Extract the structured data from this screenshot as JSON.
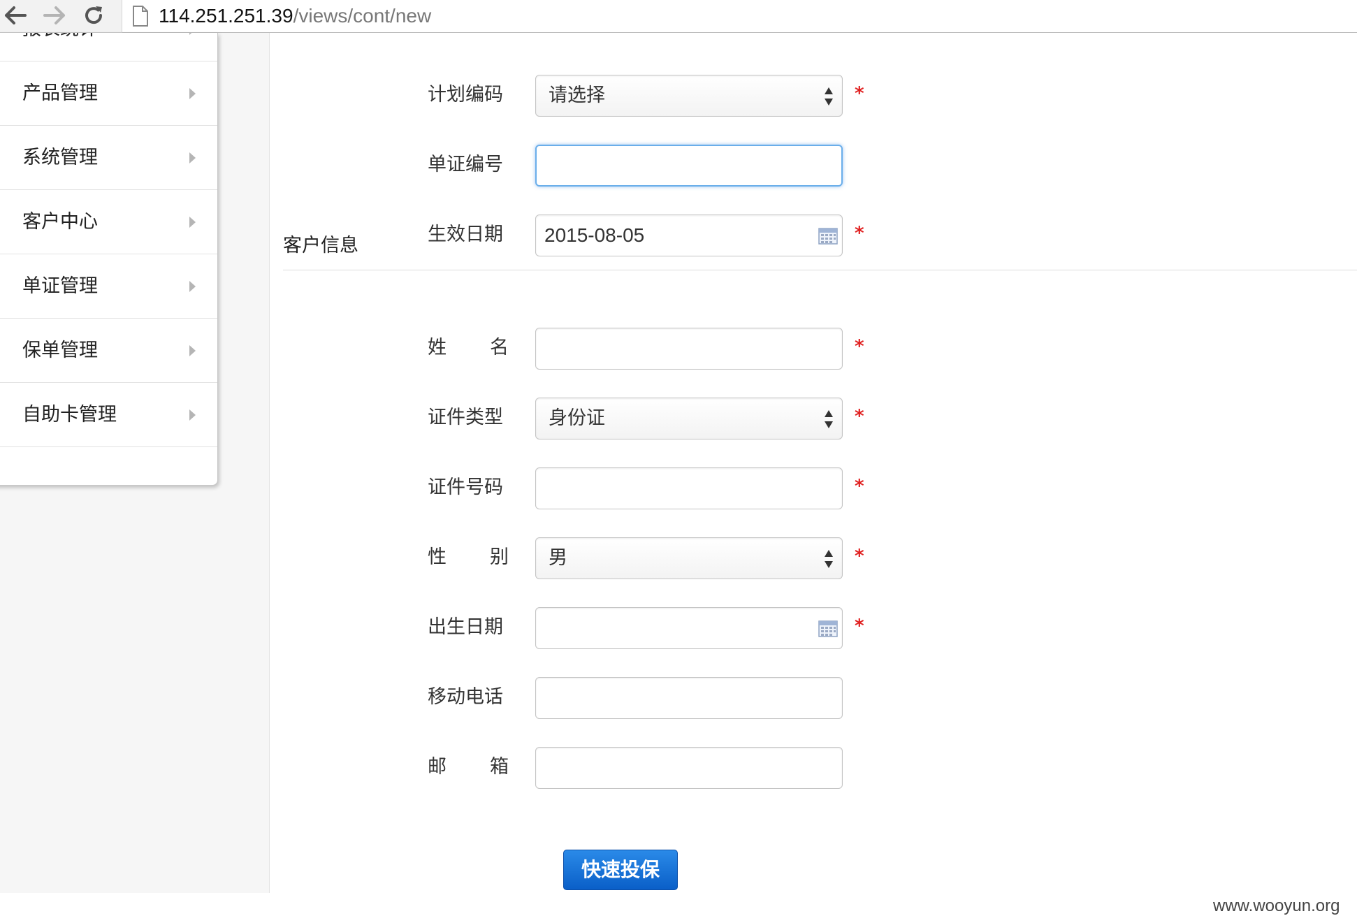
{
  "browser": {
    "url_host": "114.251.251.39",
    "url_path": "/views/cont/new"
  },
  "sidebar": {
    "items": [
      {
        "label": "报表统计"
      },
      {
        "label": "产品管理"
      },
      {
        "label": "系统管理"
      },
      {
        "label": "客户中心"
      },
      {
        "label": "单证管理"
      },
      {
        "label": "保单管理"
      },
      {
        "label": "自助卡管理"
      }
    ]
  },
  "form": {
    "section_label": "客户信息",
    "required_mark": "*",
    "plan_code": {
      "label": "计划编码",
      "value": "请选择"
    },
    "voucher_no": {
      "label": "单证编号",
      "value": ""
    },
    "effective_date": {
      "label": "生效日期",
      "value": "2015-08-05"
    },
    "name": {
      "label_1": "姓",
      "label_2": "名",
      "value": ""
    },
    "id_type": {
      "label": "证件类型",
      "value": "身份证"
    },
    "id_number": {
      "label": "证件号码",
      "value": ""
    },
    "gender": {
      "label_1": "性",
      "label_2": "别",
      "value": "男"
    },
    "birth_date": {
      "label": "出生日期",
      "value": ""
    },
    "mobile": {
      "label": "移动电话",
      "value": ""
    },
    "email": {
      "label_1": "邮",
      "label_2": "箱",
      "value": ""
    },
    "submit_label": "快速投保"
  },
  "watermark": "www.wooyun.org",
  "colors": {
    "required": "#e02020",
    "primary_button": "#0a5fc8",
    "focus_ring": "#6aaeea"
  }
}
